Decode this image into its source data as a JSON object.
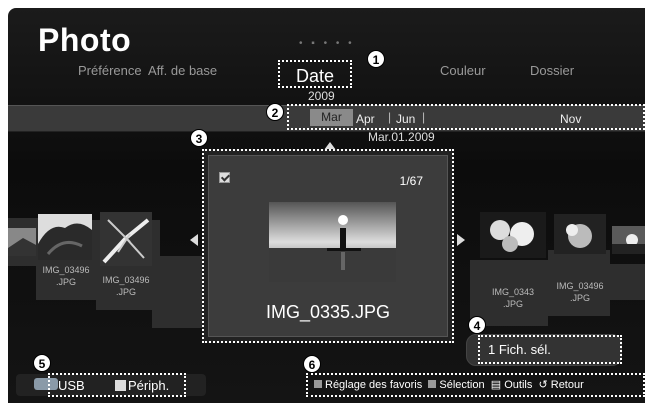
{
  "app": {
    "title": "Photo",
    "page_indicator": "• ▪ • • •"
  },
  "tabs": [
    {
      "label": "Préférence"
    },
    {
      "label": "Aff. de base"
    },
    {
      "label": "Date",
      "selected": true
    },
    {
      "label": "Couleur"
    },
    {
      "label": "Dossier"
    }
  ],
  "timeline": {
    "year": "2009",
    "months": [
      "Mar",
      "Apr",
      "Jun",
      "Nov"
    ],
    "selected_month": "Mar",
    "date_label": "Mar.01.2009"
  },
  "focused": {
    "counter": "1/67",
    "filename": "IMG_0335.JPG",
    "checked": true
  },
  "left_thumbs": [
    {
      "name_line1": "IMG_03496",
      "name_line2": ".JPG"
    },
    {
      "name_line1": "IMG_03496",
      "name_line2": ".JPG"
    }
  ],
  "right_thumbs": [
    {
      "name_line1": "IMG_0343",
      "name_line2": ".JPG"
    },
    {
      "name_line1": "IMG_03496",
      "name_line2": ".JPG"
    }
  ],
  "selection": {
    "label": "1 Fich. sél."
  },
  "source": {
    "usb_label": "USB",
    "device_label": "Périph."
  },
  "help_bar": [
    {
      "icon": "square-icon",
      "label": "Réglage des favoris"
    },
    {
      "icon": "square-icon",
      "label": "Sélection"
    },
    {
      "icon": "tools-icon",
      "label": "Outils"
    },
    {
      "icon": "return-icon",
      "label": "Retour"
    }
  ],
  "callouts": [
    "1",
    "2",
    "3",
    "4",
    "5",
    "6"
  ],
  "colors": {
    "background": "#111111",
    "timeline_bar": "#3a3a3a",
    "selected_month": "#8a8a8a"
  }
}
